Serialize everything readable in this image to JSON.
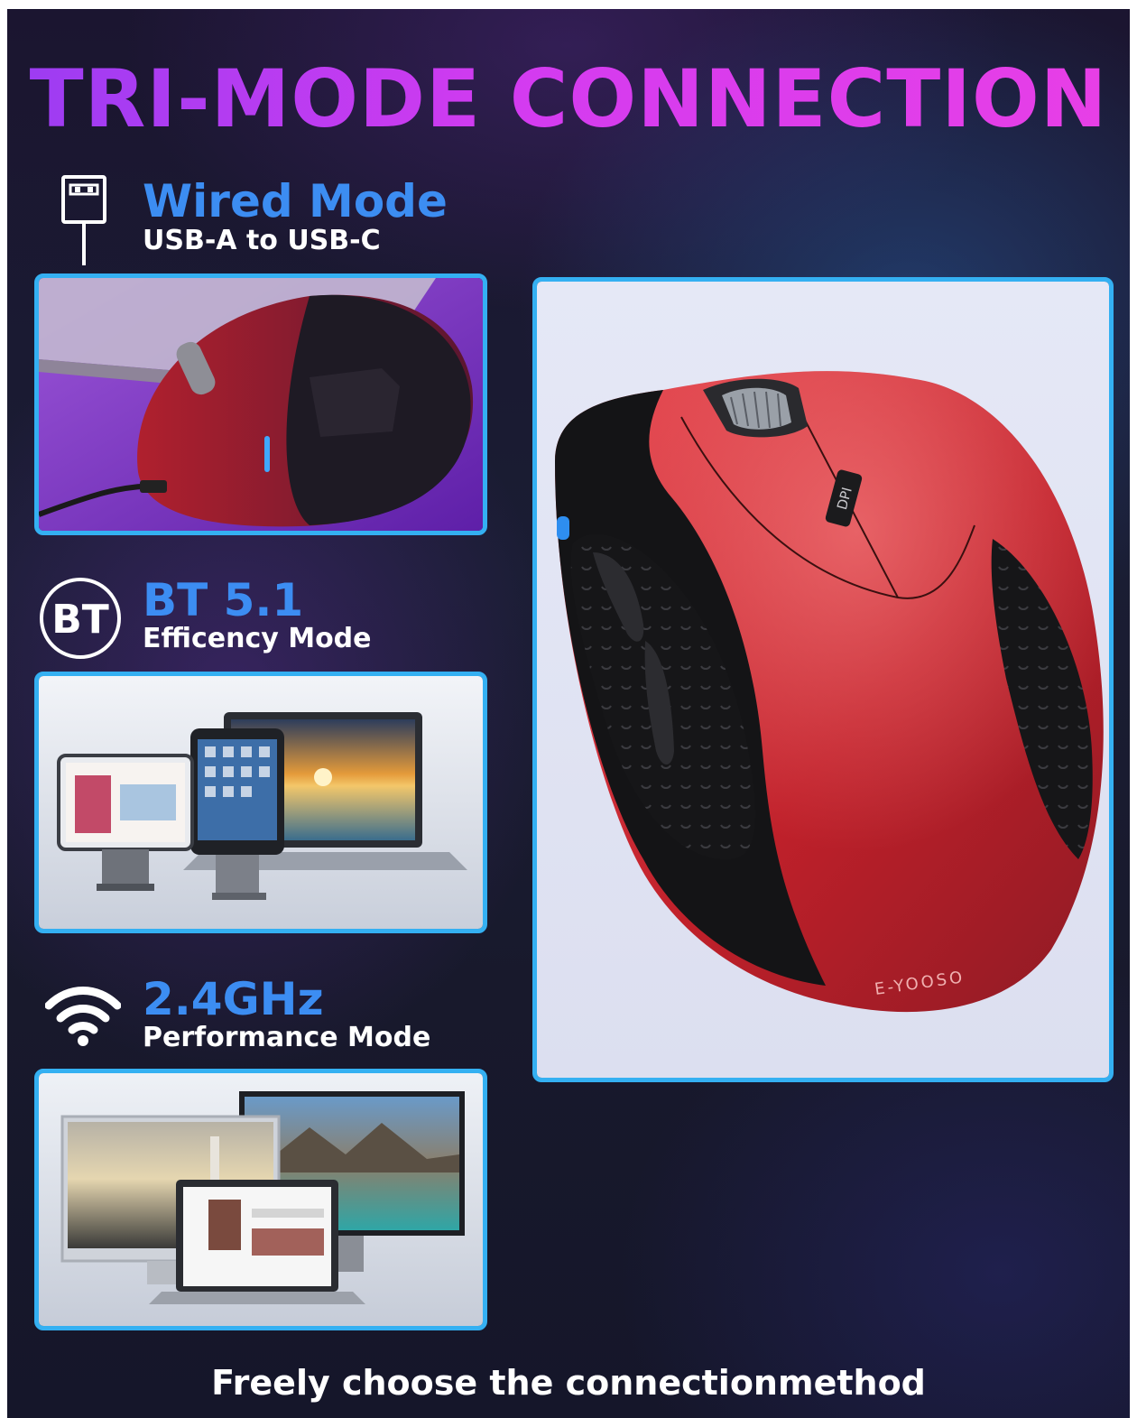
{
  "header": {
    "title": "TRI-MODE CONNECTION"
  },
  "modes": [
    {
      "icon": "usb-plug-icon",
      "title": "Wired Mode",
      "subtitle": "USB-A to USB-C"
    },
    {
      "icon": "bluetooth-bt-icon",
      "icon_text": "BT",
      "title": "BT 5.1",
      "subtitle": "Efficency Mode"
    },
    {
      "icon": "wifi-icon",
      "title": "2.4GHz",
      "subtitle": "Performance Mode"
    }
  ],
  "product": {
    "brand": "E-YOOSO",
    "dpi_label": "DPI"
  },
  "footer": {
    "text": "Freely choose the connectionmethod"
  },
  "colors": {
    "accent_blue": "#3c8df2",
    "border_cyan": "#34b0f2",
    "mouse_red": "#c0202a",
    "title_purple": "#b43cf2"
  }
}
